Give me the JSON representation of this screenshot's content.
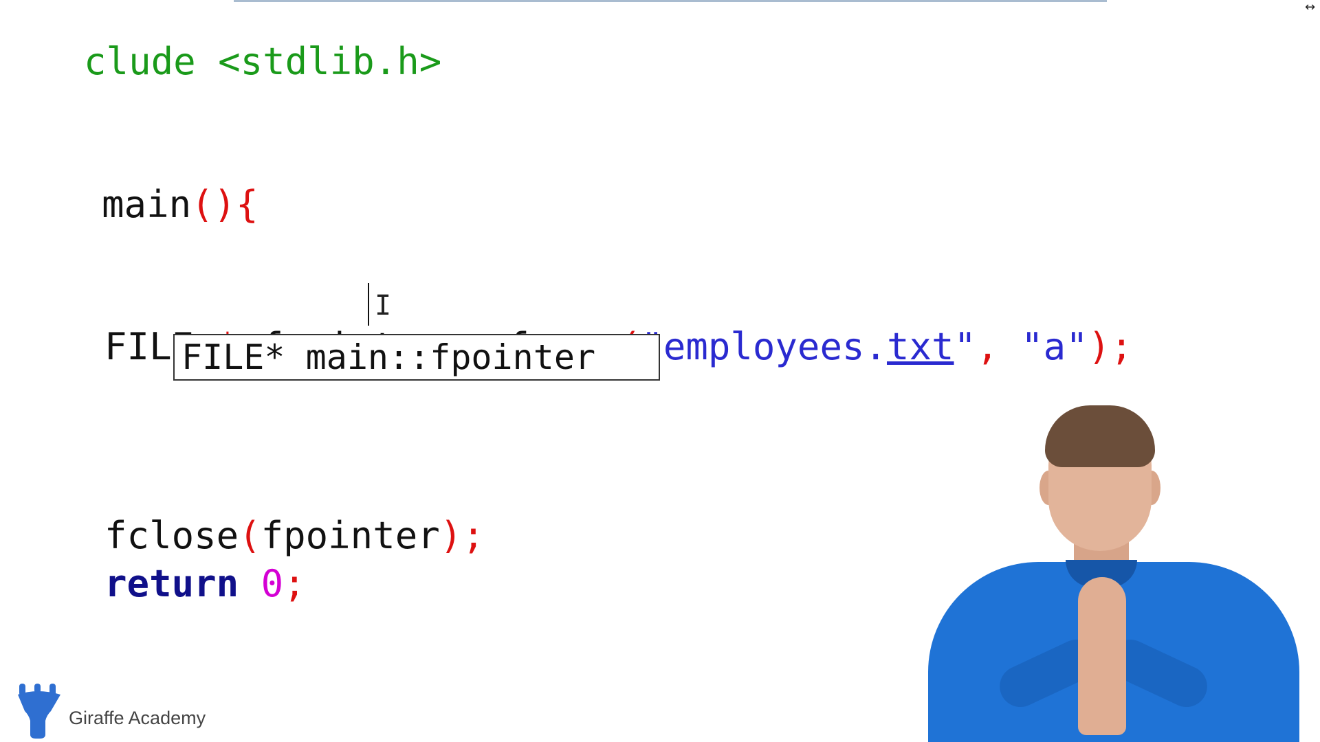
{
  "editor": {
    "line_include": {
      "directive": "clude <stdlib.h>"
    },
    "line_main": {
      "name": "main",
      "parens": "()",
      "brace": "{"
    },
    "line_fopen": {
      "type": "FILE",
      "star": "*",
      "var": "fpointer",
      "assign": "=",
      "func": "fopen",
      "open_paren": "(",
      "string_prefix": "\"employees.",
      "string_ext": "txt",
      "string_close": "\"",
      "comma": ",",
      "mode": "\"a\"",
      "close_paren": ")",
      "semicolon": ";"
    },
    "line_fclose": {
      "func": "fclose",
      "open_paren": "(",
      "arg": "fpointer",
      "close_paren": ")",
      "semicolon": ";"
    },
    "line_return": {
      "keyword": "return",
      "value": "0",
      "semicolon": ";"
    }
  },
  "tooltip": {
    "text": "FILE* main::fpointer"
  },
  "branding": {
    "icon": "giraffe-logo",
    "label": "Giraffe Academy",
    "color": "#2f6fd1"
  },
  "window": {
    "resize_glyph": "↔"
  }
}
